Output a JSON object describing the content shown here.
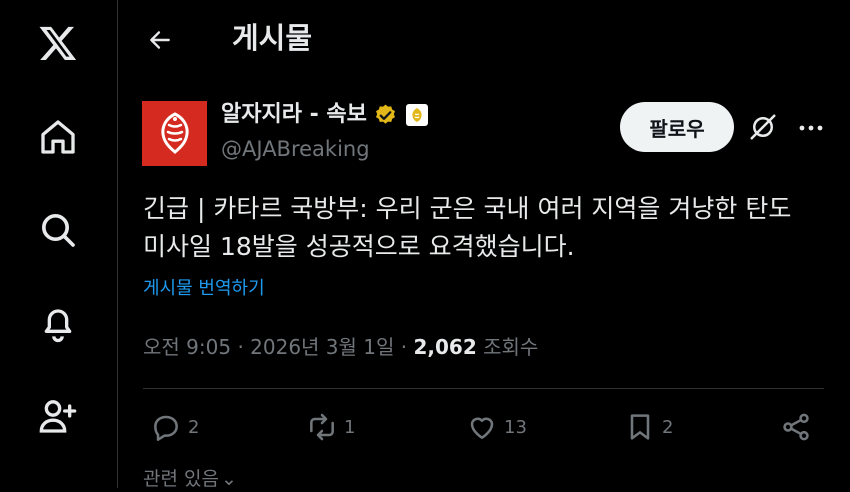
{
  "header": {
    "title": "게시물"
  },
  "tweet": {
    "author_name": "알자지라 - 속보",
    "handle": "@AJABreaking",
    "follow_label": "팔로우",
    "text_line1": "긴급 | 카타르 국방부: 우리 군은 국내 여러 지역을 겨냥한 탄도",
    "text_line2": "미사일 18발을 성공적으로 요격했습니다.",
    "translate_label": "게시물 번역하기",
    "time": "오전 9:05",
    "date": "2026년 3월 1일",
    "views_count": "2,062",
    "views_label": "조회수",
    "replies": "2",
    "reposts": "1",
    "likes": "13",
    "bookmarks": "2",
    "related_label": "관련 있음"
  },
  "colors": {
    "background": "#000000",
    "text": "#e7e9ea",
    "muted": "#71767b",
    "link": "#1d9bf0",
    "verified_gold": "#e2b719",
    "avatar_red": "#d42a1f"
  },
  "icons": {
    "sidebar": [
      "x-logo-icon",
      "home-icon",
      "search-icon",
      "bell-icon",
      "add-user-icon"
    ],
    "actions": [
      "reply-icon",
      "repost-icon",
      "like-icon",
      "bookmark-icon",
      "share-icon"
    ]
  }
}
